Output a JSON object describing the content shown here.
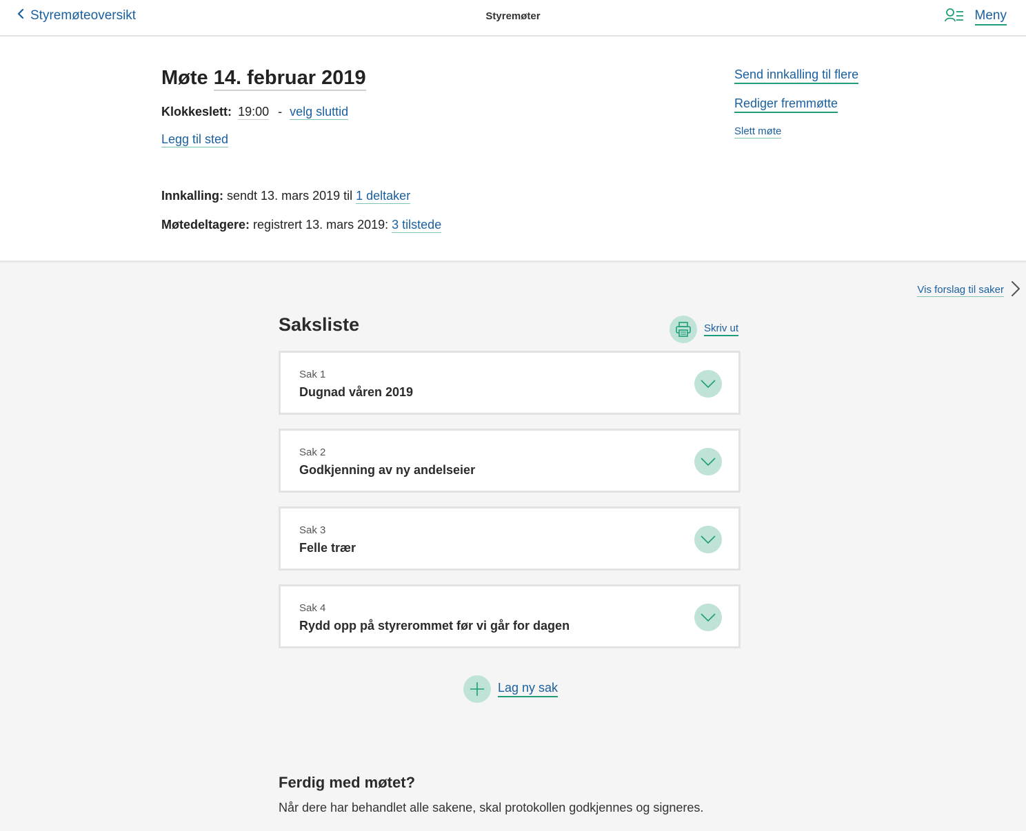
{
  "topbar": {
    "back_label": "Styremøteoversikt",
    "title": "Styremøter",
    "menu_label": "Meny"
  },
  "meeting": {
    "title_prefix": "Møte",
    "date": "14. februar 2019",
    "time_label": "Klokkeslett:",
    "time_value": "19:00",
    "time_separator": "-",
    "end_time_link": "velg sluttid",
    "add_place_link": "Legg til sted",
    "invite_label": "Innkalling:",
    "invite_text": "sendt 13. mars 2019 til",
    "invite_link": "1 deltaker",
    "attendees_label": "Møtedeltagere:",
    "attendees_text": "registrert 13. mars 2019:",
    "attendees_link": "3 tilstede"
  },
  "actions": {
    "send_invite": "Send innkalling til flere",
    "edit_attendance": "Rediger fremmøtte",
    "delete_meeting": "Slett møte"
  },
  "agenda": {
    "suggest_link": "Vis forslag til saker",
    "title": "Saksliste",
    "print_label": "Skriv ut",
    "items": [
      {
        "number": "Sak 1",
        "title": "Dugnad våren 2019"
      },
      {
        "number": "Sak 2",
        "title": "Godkjenning av ny andelseier"
      },
      {
        "number": "Sak 3",
        "title": "Felle trær"
      },
      {
        "number": "Sak 4",
        "title": "Rydd opp på styrerommet før vi går for dagen"
      }
    ],
    "new_item_label": "Lag ny sak"
  },
  "finish": {
    "title": "Ferdig med møtet?",
    "text": "Når dere har behandlet alle sakene, skal protokollen godkjennes og signeres."
  },
  "colors": {
    "link": "#1a5f9e",
    "accent": "#1f9d7a",
    "accent_light": "#bfe3d6",
    "background_grey": "#f5f5f5"
  }
}
